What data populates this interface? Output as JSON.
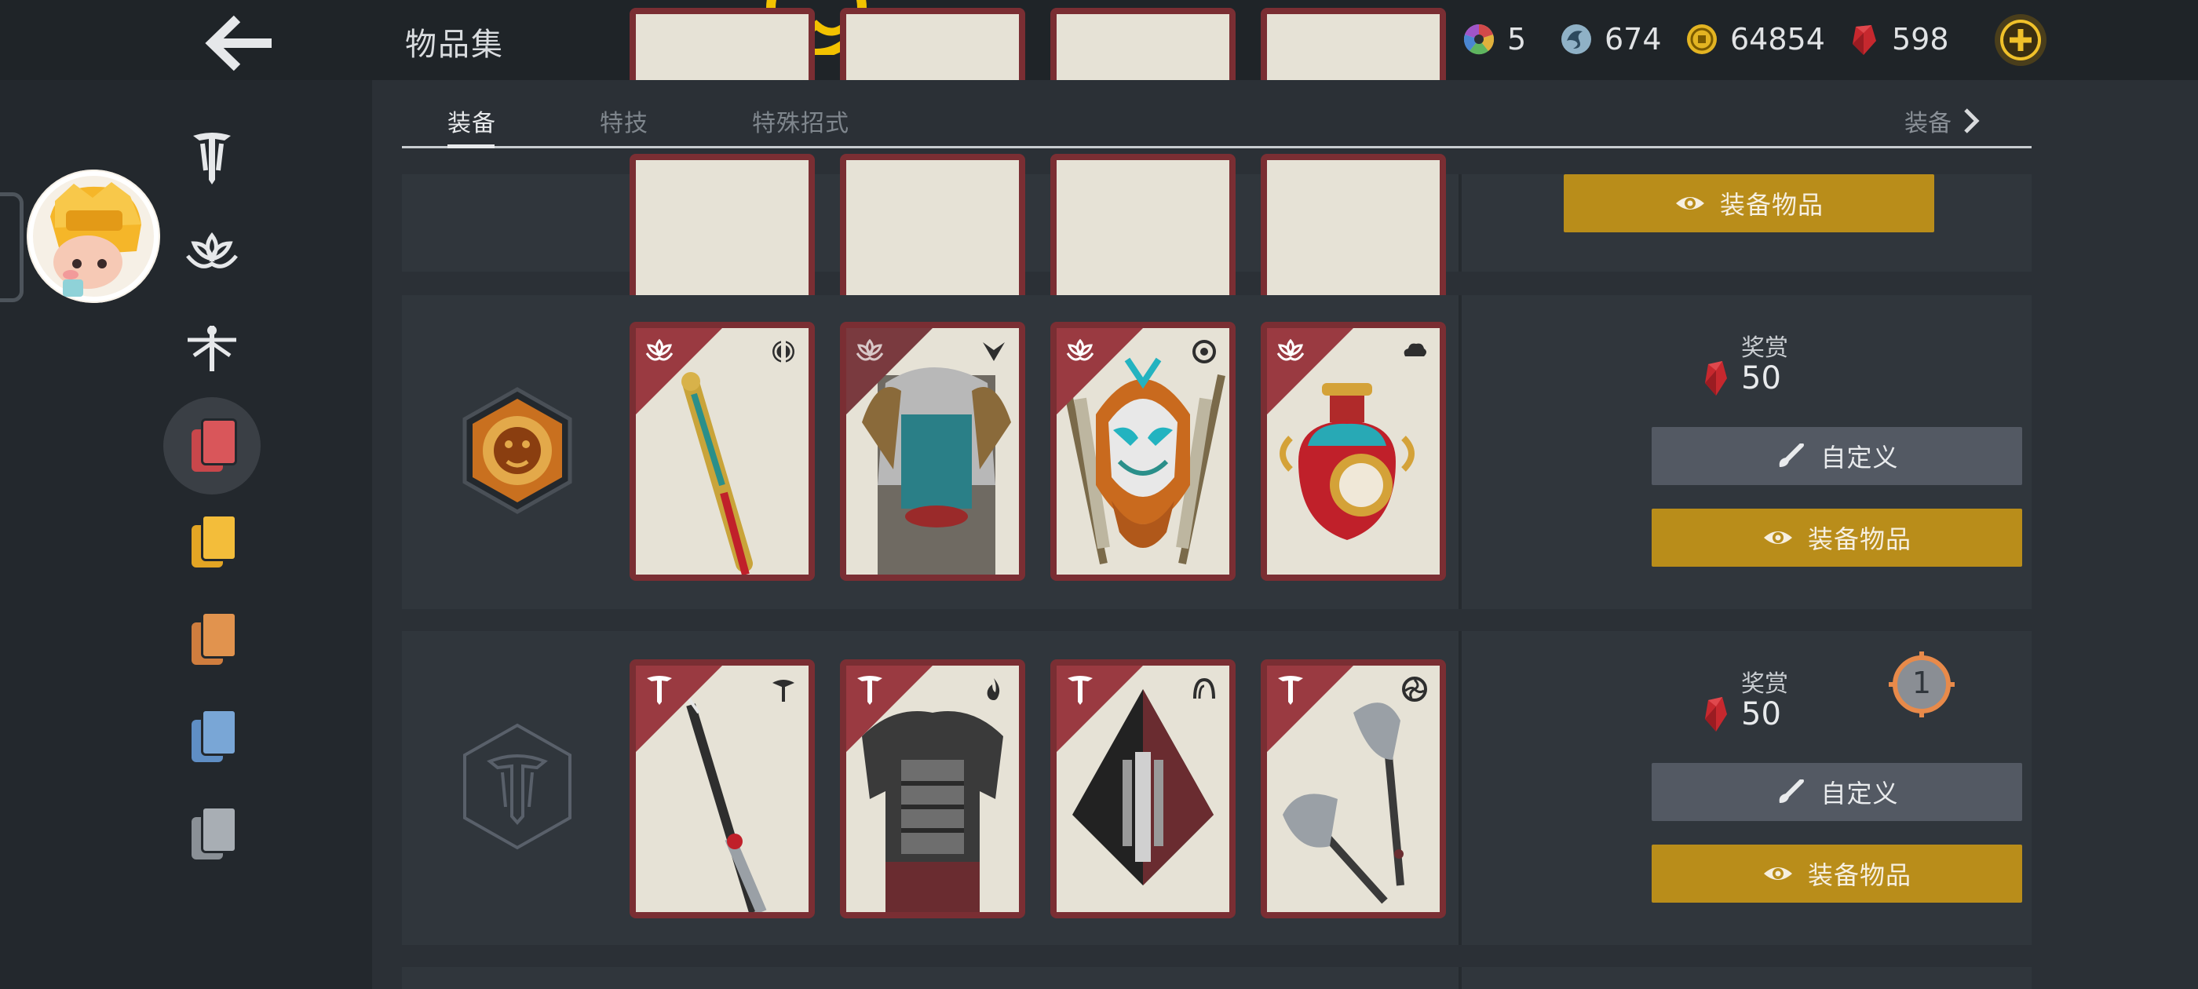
{
  "header": {
    "title": "物品集",
    "currencies": [
      {
        "name": "color-orb",
        "value": "5"
      },
      {
        "name": "steel",
        "value": "674"
      },
      {
        "name": "coin",
        "value": "64854"
      },
      {
        "name": "gem",
        "value": "598"
      }
    ]
  },
  "tabs": {
    "items": [
      "装备",
      "特技",
      "特殊招式"
    ],
    "more_label": "装备"
  },
  "rows": [
    {
      "equip_label": "装备物品"
    },
    {
      "reward_label": "奖赏",
      "reward_value": "50",
      "customize_label": "自定义",
      "equip_label": "装备物品"
    },
    {
      "reward_label": "奖赏",
      "reward_value": "50",
      "customize_label": "自定义",
      "equip_label": "装备物品",
      "notification_count": "1"
    }
  ],
  "colors": {
    "gold_button": "#b98d1a",
    "gray_button": "#535963",
    "card_frame": "#7a2e33",
    "accent_orange": "#e88a4a"
  }
}
